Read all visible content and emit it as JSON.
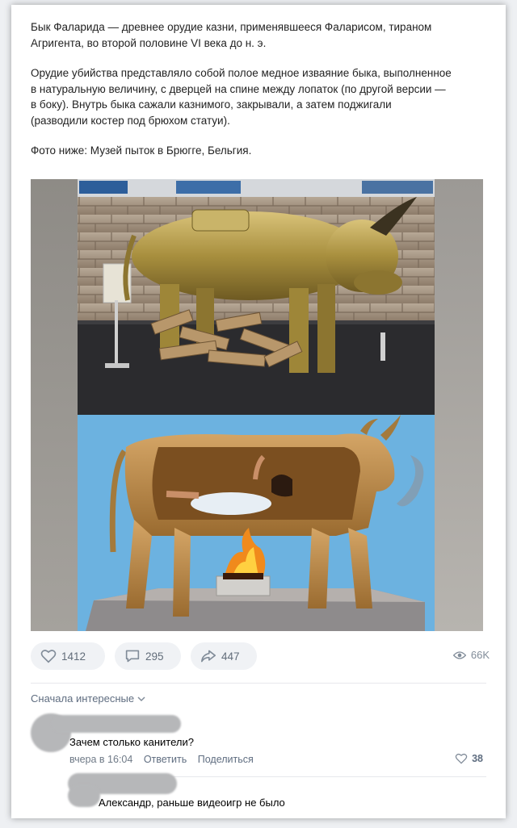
{
  "post": {
    "paragraphs": [
      "Бык Фаларида — древнее орудие казни, применявшееся Фаларисом, тираном\nАгригента, во второй половине VI века до н. э.",
      "Орудие убийства представляло собой полое медное изваяние быка, выполненное\nв натуральную величину, с дверцей на спине между лопаток (по другой версии —\nв боку). Внутрь быка сажали казнимого, закрывали, а затем поджигали\n(разводили костер под брюхом статуи).",
      "Фото ниже: Музей пыток в Брюгге, Бельгия."
    ]
  },
  "actions": {
    "likes": "1412",
    "comments": "295",
    "shares": "447",
    "views": "66K"
  },
  "icons": {
    "like": "heart-icon",
    "comment": "comment-bubble-icon",
    "share": "share-arrow-icon",
    "views": "eye-icon",
    "sort": "chevron-down-icon"
  },
  "comments": {
    "sort_label": "Сначала интересные",
    "items": [
      {
        "text": "Зачем столько канители?",
        "time": "вчера в 16:04",
        "reply": "Ответить",
        "share": "Поделиться",
        "likes": "38"
      },
      {
        "text": "Александр, раньше видеоигр не было"
      }
    ]
  },
  "colors": {
    "accent": "#5f6d80",
    "sky": "#6cb2e0",
    "bronze": "#b8864a"
  }
}
